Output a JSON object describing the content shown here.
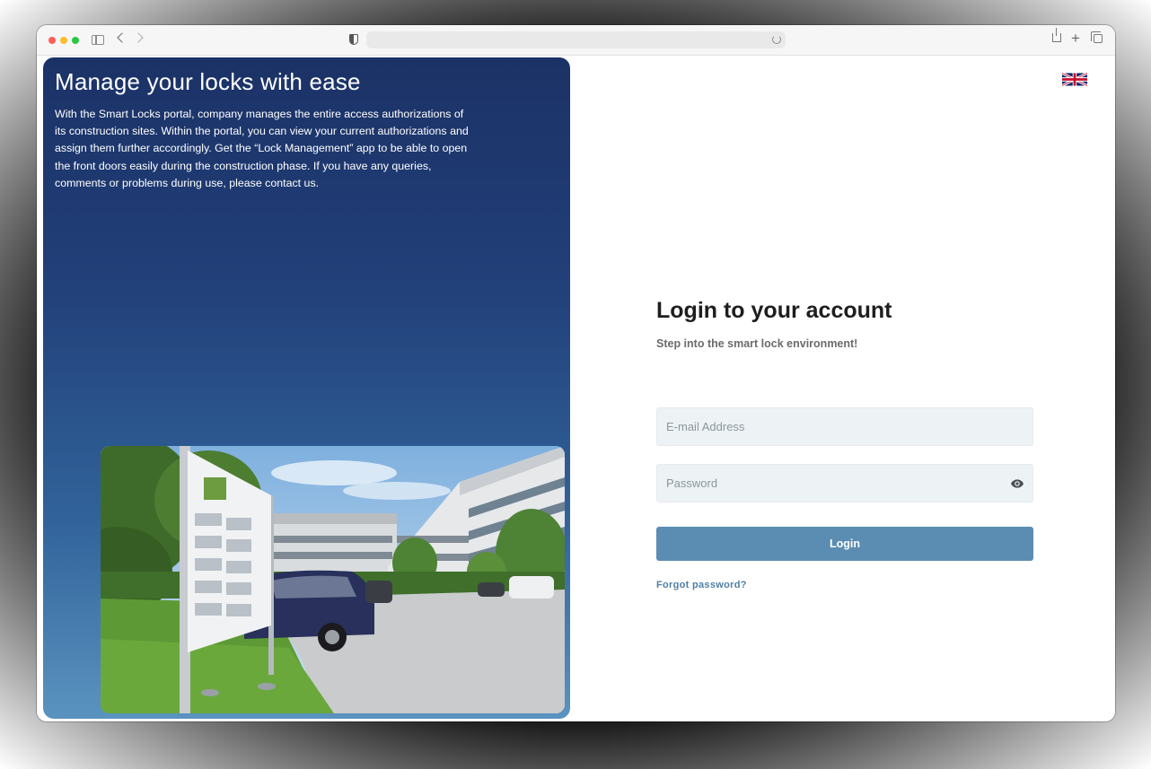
{
  "browser": {
    "address_text": ""
  },
  "hero": {
    "title": "Manage your locks with ease",
    "description": "With the Smart Locks portal, company manages the entire access authorizations of its construction sites. Within the portal, you can view your current authorizations and assign them further accordingly. Get the “Lock Management” app to be able to open the front doors easily during the construction phase. If you have any queries, comments or problems during use, please contact us.",
    "image_icon": "office-building-photo"
  },
  "language": {
    "icon": "uk-flag-icon"
  },
  "login": {
    "title": "Login to your account",
    "subtitle": "Step into the smart lock environment!",
    "email_placeholder": "E-mail Address",
    "email_value": "",
    "password_placeholder": "Password",
    "password_value": "",
    "password_toggle_icon": "eye-icon",
    "button_label": "Login",
    "forgot_label": "Forgot password?"
  },
  "colors": {
    "hero_gradient_top": "#1b3266",
    "hero_gradient_bottom": "#5a93c0",
    "button": "#5b8db2",
    "link": "#4f7fa6",
    "input_bg": "#edf2f5"
  }
}
